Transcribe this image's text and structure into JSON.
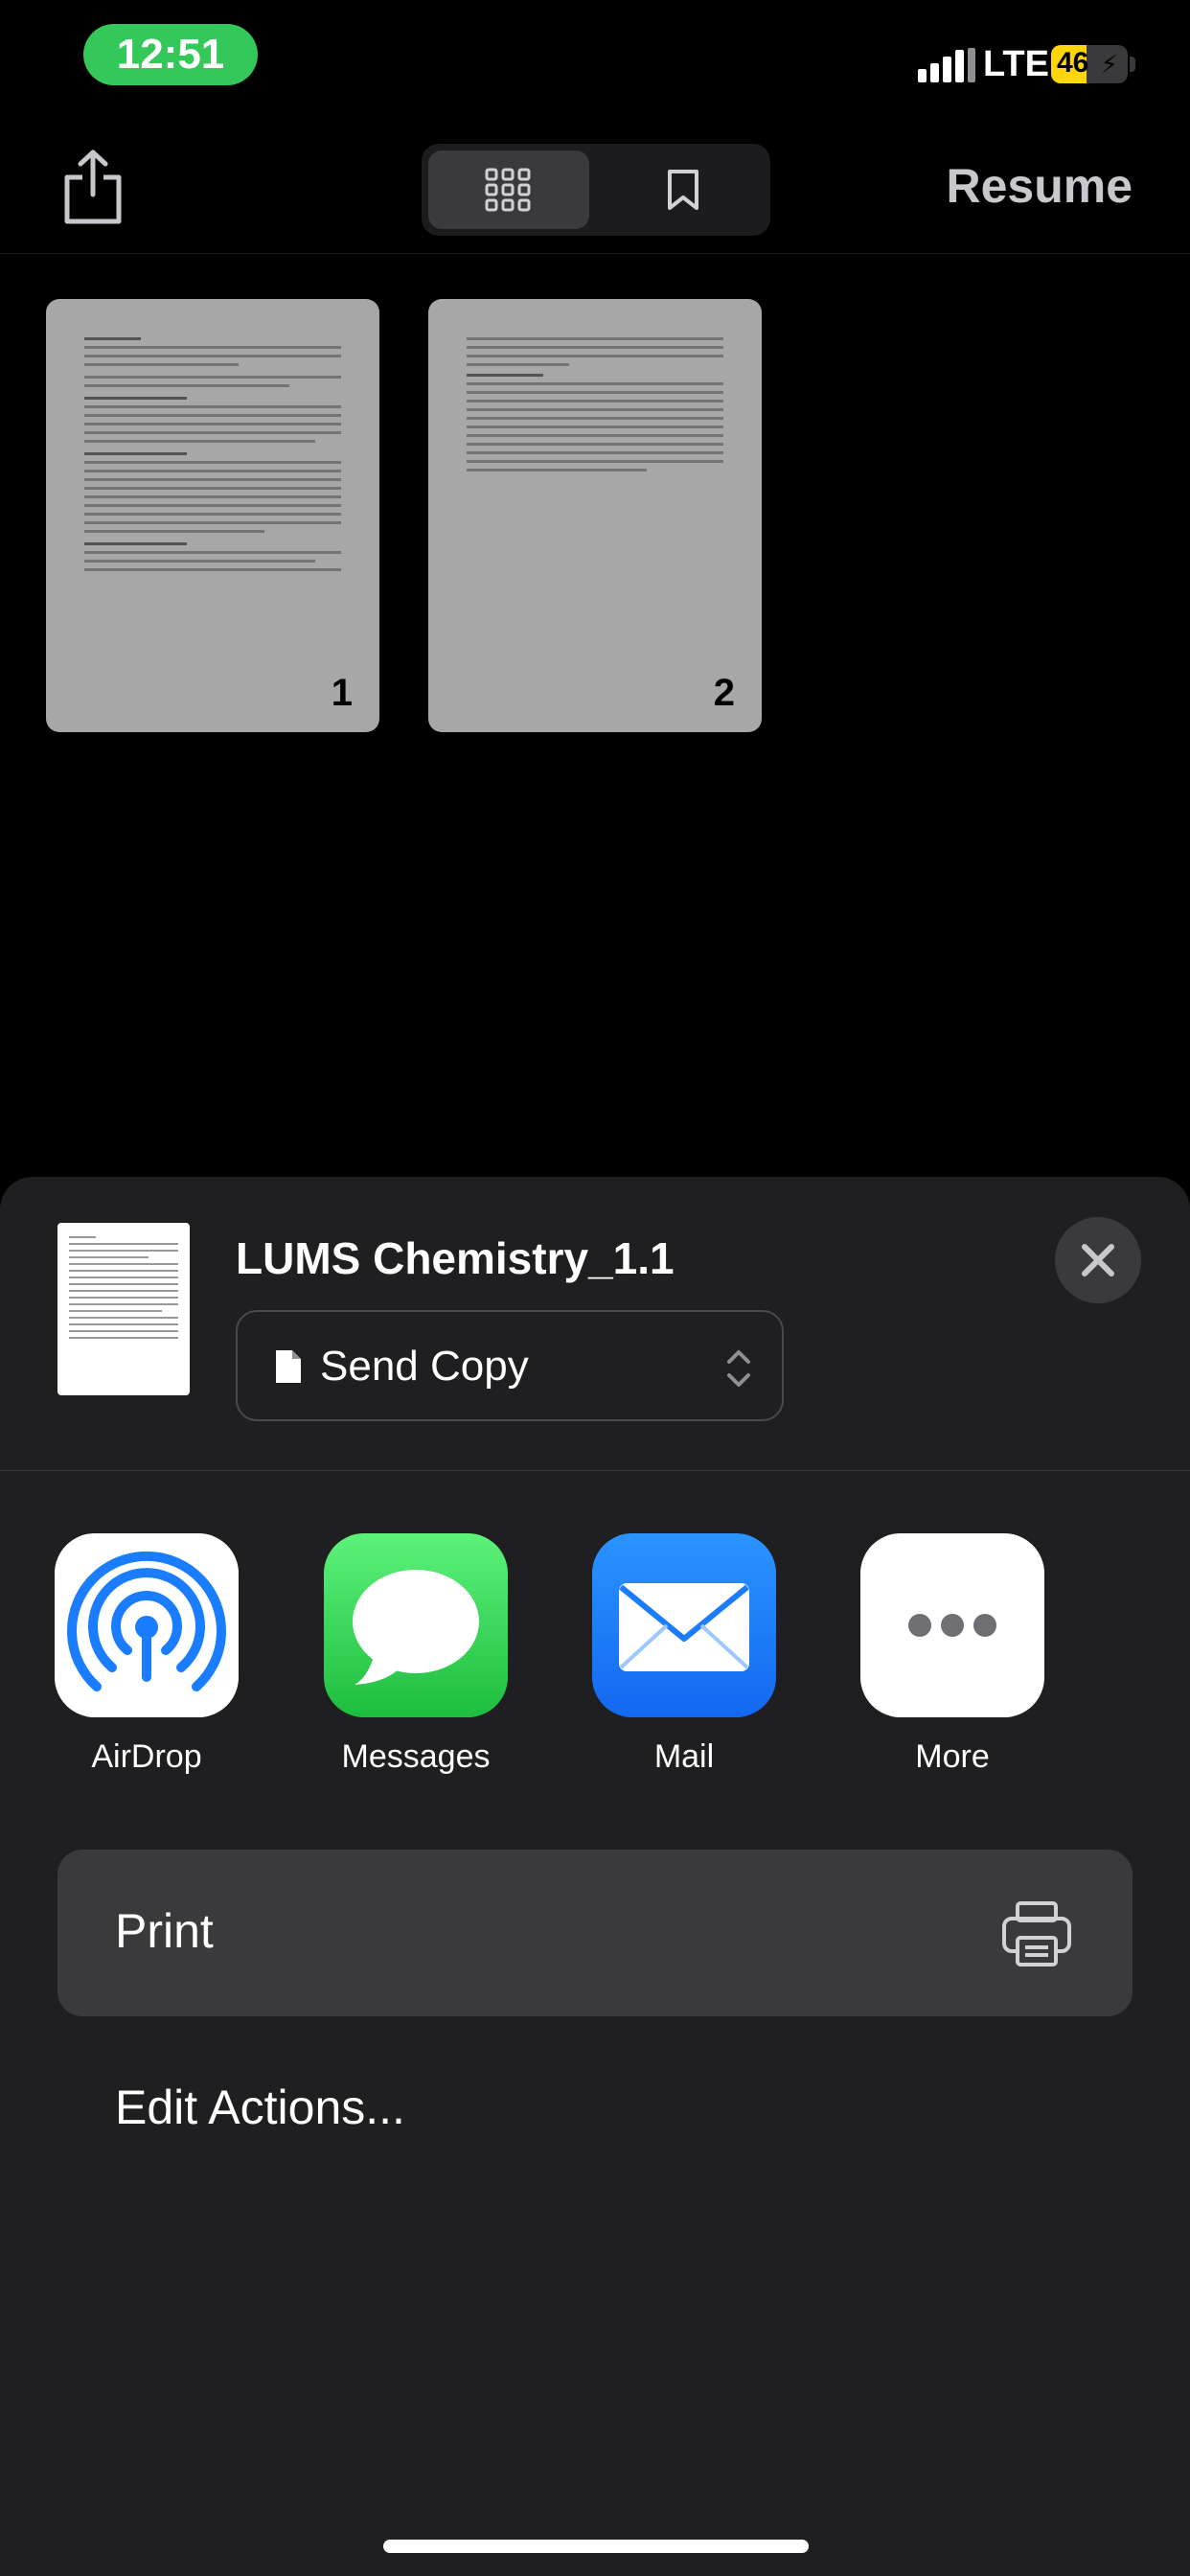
{
  "status_bar": {
    "time": "12:51",
    "network": "LTE",
    "battery_percent": "46",
    "battery_level": 0.46,
    "icons": [
      "signal-icon",
      "battery-charging-icon"
    ]
  },
  "toolbar": {
    "resume_label": "Resume",
    "segments": [
      "grid-view",
      "bookmarks"
    ],
    "selected_segment": "grid-view"
  },
  "pages": [
    {
      "number": "1"
    },
    {
      "number": "2"
    }
  ],
  "share_sheet": {
    "doc_title": "LUMS Chemistry_1.1",
    "send_option": "Send Copy",
    "apps": [
      {
        "label": "AirDrop",
        "icon": "airdrop-icon"
      },
      {
        "label": "Messages",
        "icon": "messages-icon"
      },
      {
        "label": "Mail",
        "icon": "mail-icon"
      },
      {
        "label": "More",
        "icon": "more-icon"
      }
    ],
    "actions": {
      "print_label": "Print",
      "edit_actions_label": "Edit Actions..."
    }
  },
  "colors": {
    "background": "#000000",
    "sheet": "#1f1f21",
    "time_pill": "#34c759",
    "battery": "#ffd60a",
    "mail": "#1a7cff",
    "messages": "#34c759"
  }
}
